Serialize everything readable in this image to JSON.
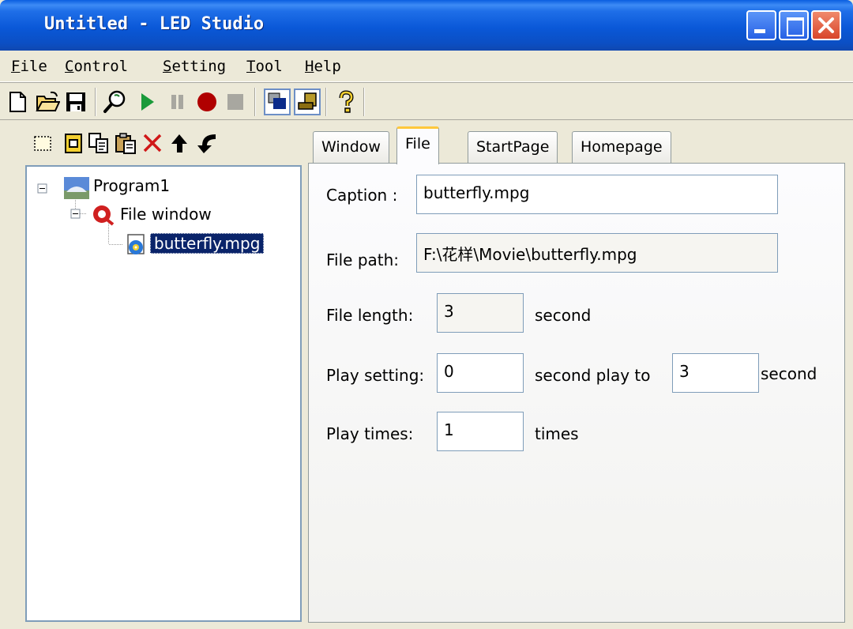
{
  "window": {
    "title": "Untitled - LED Studio"
  },
  "menu": [
    "File",
    "Control",
    "Setting",
    "Tool",
    "Help"
  ],
  "tree": {
    "root": "Program1",
    "child": "File window",
    "leaf": "butterfly.mpg"
  },
  "tabs": [
    "Window",
    "File",
    "StartPage",
    "Homepage"
  ],
  "active_tab": "File",
  "form": {
    "caption_label": "Caption :",
    "caption_value": "butterfly.mpg",
    "path_label": "File path:",
    "path_value": "F:\\花样\\Movie\\butterfly.mpg",
    "length_label": "File length:",
    "length_value": "3",
    "length_unit": "second",
    "play_label": "Play setting:",
    "play_start": "0",
    "play_mid": "second play to",
    "play_end": "3",
    "play_unit": "second",
    "times_label": "Play times:",
    "times_value": "1",
    "times_unit": "times"
  },
  "colors": {
    "titlebar": "#0a58d8",
    "selection": "#0a246a",
    "active_tab_accent": "#ffc83c",
    "play_green": "#1a9a3a",
    "record_red": "#b00000"
  }
}
